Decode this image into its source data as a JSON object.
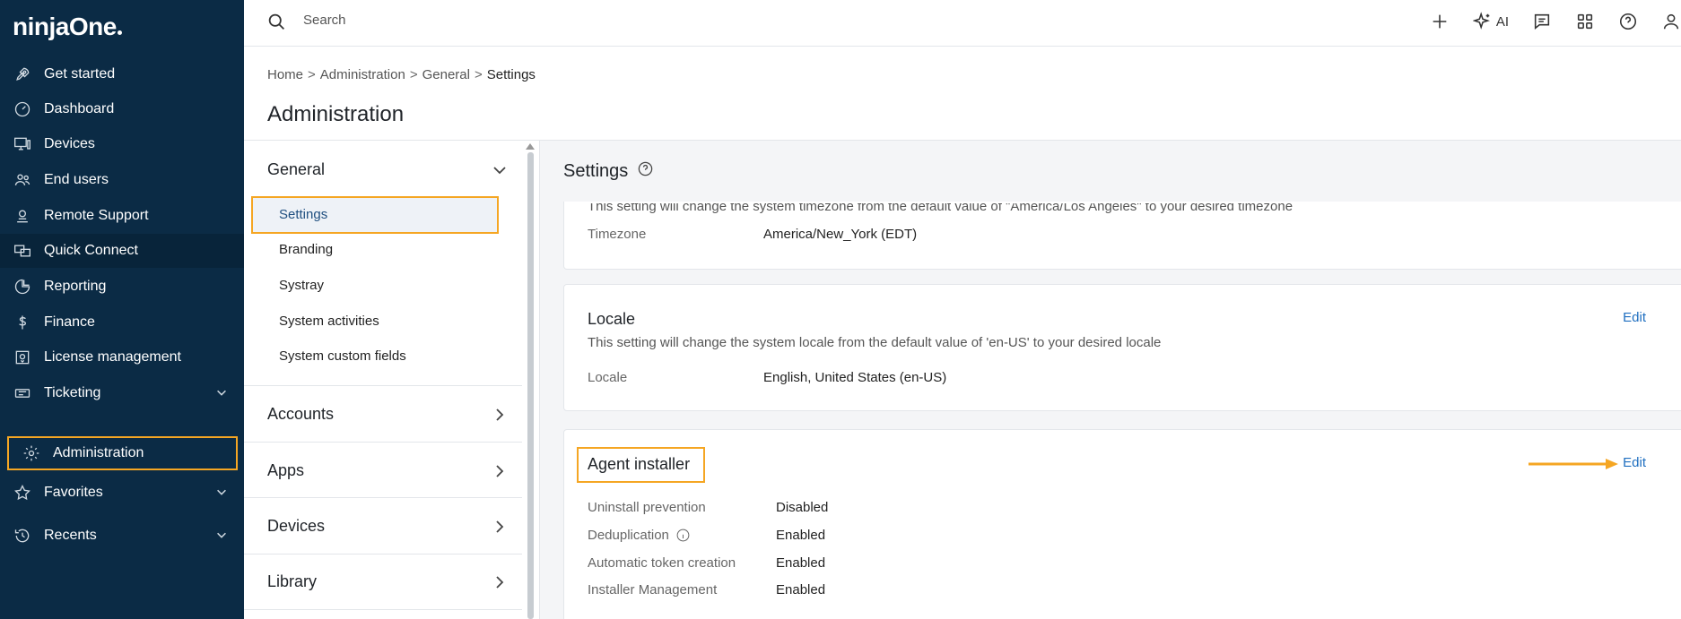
{
  "app": {
    "logo": "ninjaOne"
  },
  "sidebar": {
    "items": [
      {
        "label": "Get started",
        "icon": "rocket-icon"
      },
      {
        "label": "Dashboard",
        "icon": "gauge-icon"
      },
      {
        "label": "Devices",
        "icon": "monitor-icon"
      },
      {
        "label": "End users",
        "icon": "users-icon"
      },
      {
        "label": "Remote Support",
        "icon": "headset-icon"
      },
      {
        "label": "Quick Connect",
        "icon": "screens-icon"
      },
      {
        "label": "Reporting",
        "icon": "pie-chart-icon"
      },
      {
        "label": "Finance",
        "icon": "dollar-icon"
      },
      {
        "label": "License management",
        "icon": "license-icon"
      },
      {
        "label": "Ticketing",
        "icon": "ticket-icon"
      },
      {
        "label": "Administration",
        "icon": "gear-icon"
      },
      {
        "label": "Favorites",
        "icon": "star-icon"
      },
      {
        "label": "Recents",
        "icon": "history-icon"
      }
    ]
  },
  "topbar": {
    "search_placeholder": "Search",
    "ai_label": "AI"
  },
  "header": {
    "breadcrumb": [
      "Home",
      "Administration",
      "General",
      "Settings"
    ],
    "title": "Administration"
  },
  "subnav": {
    "general": {
      "title": "General",
      "items": [
        "Settings",
        "Branding",
        "Systray",
        "System activities",
        "System custom fields"
      ]
    },
    "groups": [
      "Accounts",
      "Apps",
      "Devices",
      "Library"
    ]
  },
  "main": {
    "title": "Settings",
    "timezone_card": {
      "desc": "This setting will change the system timezone from the default value of \"America/Los Angeles\" to your desired timezone",
      "label": "Timezone",
      "value": "America/New_York (EDT)"
    },
    "locale_card": {
      "title": "Locale",
      "desc": "This setting will change the system locale from the default value of 'en-US' to your desired locale",
      "label": "Locale",
      "value": "English, United States (en-US)",
      "edit": "Edit"
    },
    "agent_card": {
      "title": "Agent installer",
      "edit": "Edit",
      "rows": [
        {
          "label": "Uninstall prevention",
          "value": "Disabled"
        },
        {
          "label": "Deduplication",
          "value": "Enabled"
        },
        {
          "label": "Automatic token creation",
          "value": "Enabled"
        },
        {
          "label": "Installer Management",
          "value": "Enabled"
        }
      ]
    }
  },
  "colors": {
    "sidebar_bg": "#0b2b45",
    "highlight": "#f5a623",
    "link": "#1f6fc0"
  }
}
